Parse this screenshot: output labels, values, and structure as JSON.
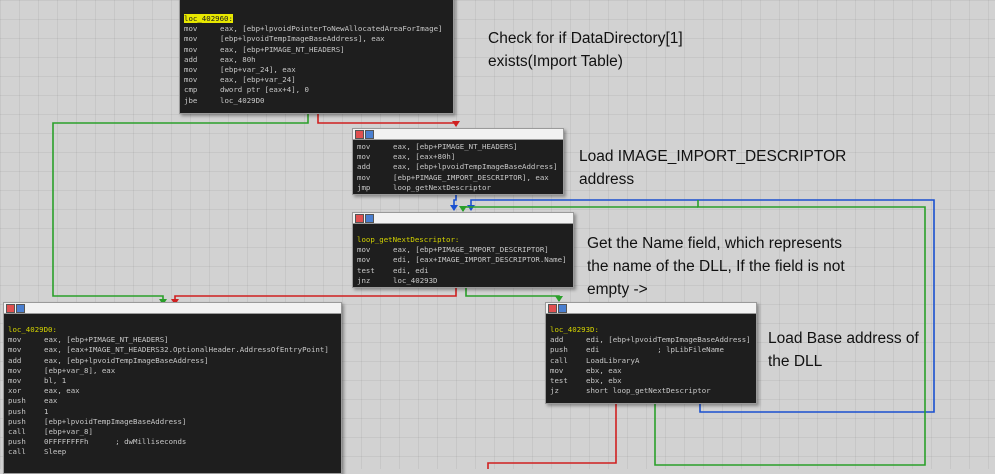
{
  "blocks": {
    "top": {
      "label": "loc_402960:",
      "lines": [
        {
          "mn": "mov",
          "op": "eax, [ebp+lpvoidPointerToNewAllocatedAreaForImage]"
        },
        {
          "mn": "mov",
          "op": "[ebp+lpvoidTempImageBaseAddress], eax"
        },
        {
          "mn": "mov",
          "op": "eax, [ebp+PIMAGE_NT_HEADERS]"
        },
        {
          "mn": "add",
          "op": "eax, 80h"
        },
        {
          "mn": "mov",
          "op": "[ebp+var_24], eax"
        },
        {
          "mn": "mov",
          "op": "eax, [ebp+var_24]"
        },
        {
          "mn": "cmp",
          "op": "dword ptr [eax+4], 0"
        },
        {
          "mn": "jbe",
          "op": "loc_4029D0"
        }
      ]
    },
    "load_desc": {
      "lines": [
        {
          "mn": "mov",
          "op": "eax, [ebp+PIMAGE_NT_HEADERS]"
        },
        {
          "mn": "mov",
          "op": "eax, [eax+80h]"
        },
        {
          "mn": "add",
          "op": "eax, [ebp+lpvoidTempImageBaseAddress]"
        },
        {
          "mn": "mov",
          "op": "[ebp+PIMAGE_IMPORT_DESCRIPTOR], eax"
        },
        {
          "mn": "jmp",
          "op": "loop_getNextDescriptor"
        }
      ]
    },
    "loop": {
      "label": "loop_getNextDescriptor:",
      "lines": [
        {
          "mn": "mov",
          "op": "eax, [ebp+PIMAGE_IMPORT_DESCRIPTOR]"
        },
        {
          "mn": "mov",
          "op": "edi, [eax+IMAGE_IMPORT_DESCRIPTOR.Name]"
        },
        {
          "mn": "test",
          "op": "edi, edi"
        },
        {
          "mn": "jnz",
          "op": "loc_40293D"
        }
      ]
    },
    "left": {
      "label": "loc_4029D0:",
      "lines": [
        {
          "mn": "mov",
          "op": "eax, [ebp+PIMAGE_NT_HEADERS]"
        },
        {
          "mn": "mov",
          "op": "eax, [eax+IMAGE_NT_HEADERS32.OptionalHeader.AddressOfEntryPoint]"
        },
        {
          "mn": "add",
          "op": "eax, [ebp+lpvoidTempImageBaseAddress]"
        },
        {
          "mn": "mov",
          "op": "[ebp+var_8], eax"
        },
        {
          "mn": "mov",
          "op": "bl, 1"
        },
        {
          "mn": "xor",
          "op": "eax, eax"
        },
        {
          "mn": "push",
          "op": "eax"
        },
        {
          "mn": "push",
          "op": "1"
        },
        {
          "mn": "push",
          "op": "[ebp+lpvoidTempImageBaseAddress]"
        },
        {
          "mn": "call",
          "op": "[ebp+var_8]"
        },
        {
          "mn": "push",
          "op": "0FFFFFFFFh      ; dwMilliseconds"
        },
        {
          "mn": "call",
          "op": "Sleep"
        }
      ]
    },
    "right": {
      "label": "loc_40293D:",
      "lines": [
        {
          "mn": "add",
          "op": "edi, [ebp+lpvoidTempImageBaseAddress]"
        },
        {
          "mn": "push",
          "op": "edi             ; lpLibFileName"
        },
        {
          "mn": "call",
          "op": "LoadLibraryA"
        },
        {
          "mn": "mov",
          "op": "ebx, eax"
        },
        {
          "mn": "test",
          "op": "ebx, ebx"
        },
        {
          "mn": "jz",
          "op": "short loop_getNextDescriptor"
        }
      ]
    }
  },
  "notes": {
    "n1": "Check for if DataDirectory[1]\nexists(Import Table)",
    "n2": "Load IMAGE_IMPORT_DESCRIPTOR\naddress",
    "n3": "Get the Name field, which represents\nthe name of the DLL, If the field is not\nempty ->",
    "n4": "Load Base address of\nthe DLL"
  },
  "colors": {
    "background": "#d2d2d2",
    "block_bg": "#1e1e1e",
    "edge_true": "#2aa02a",
    "edge_false": "#d02020",
    "edge_jump": "#1a50d0",
    "label": "#d4d400"
  }
}
